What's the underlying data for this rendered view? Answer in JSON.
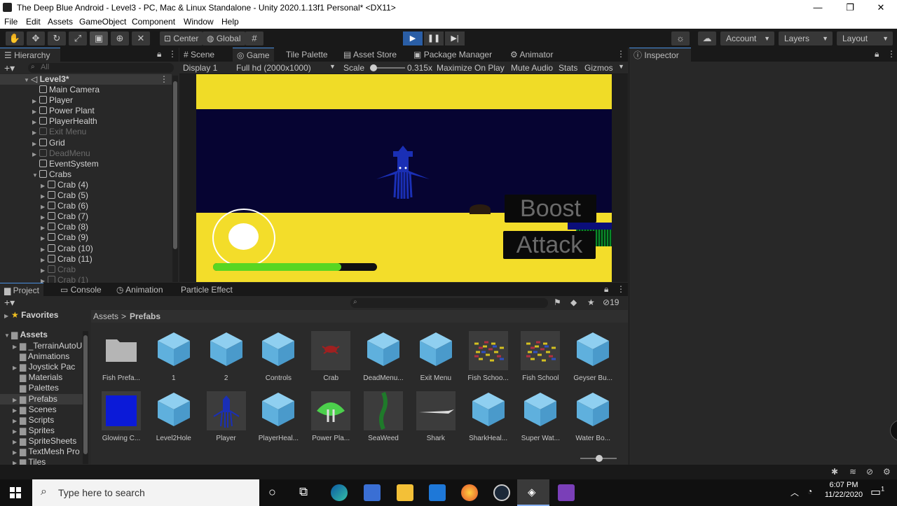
{
  "window": {
    "title": "The Deep Blue Android - Level3 - PC, Mac & Linux Standalone - Unity 2020.1.13f1 Personal* <DX11>",
    "minimize": "—",
    "maximize": "❐",
    "close": "✕"
  },
  "menu": [
    "File",
    "Edit",
    "Assets",
    "GameObject",
    "Component",
    "Window",
    "Help"
  ],
  "toolbar": {
    "pivot_label": "Center",
    "space_label": "Global",
    "account_label": "Account",
    "layers_label": "Layers",
    "layout_label": "Layout"
  },
  "hierarchy": {
    "tab": "Hierarchy",
    "search_placeholder": "All",
    "scene": "Level3*",
    "items": [
      {
        "label": "Main Camera",
        "dim": false,
        "indent": 1,
        "arrow": false
      },
      {
        "label": "Player",
        "dim": false,
        "indent": 1,
        "arrow": true
      },
      {
        "label": "Power Plant",
        "dim": false,
        "indent": 1,
        "arrow": true
      },
      {
        "label": "PlayerHealth",
        "dim": false,
        "indent": 1,
        "arrow": true
      },
      {
        "label": "Exit Menu",
        "dim": true,
        "indent": 1,
        "arrow": true
      },
      {
        "label": "Grid",
        "dim": false,
        "indent": 1,
        "arrow": true
      },
      {
        "label": "DeadMenu",
        "dim": true,
        "indent": 1,
        "arrow": true
      },
      {
        "label": "EventSystem",
        "dim": false,
        "indent": 1,
        "arrow": false
      },
      {
        "label": "Crabs",
        "dim": false,
        "indent": 1,
        "arrow": "open"
      },
      {
        "label": "Crab (4)",
        "dim": false,
        "indent": 2,
        "arrow": true
      },
      {
        "label": "Crab (5)",
        "dim": false,
        "indent": 2,
        "arrow": true
      },
      {
        "label": "Crab (6)",
        "dim": false,
        "indent": 2,
        "arrow": true
      },
      {
        "label": "Crab (7)",
        "dim": false,
        "indent": 2,
        "arrow": true
      },
      {
        "label": "Crab (8)",
        "dim": false,
        "indent": 2,
        "arrow": true
      },
      {
        "label": "Crab (9)",
        "dim": false,
        "indent": 2,
        "arrow": true
      },
      {
        "label": "Crab (10)",
        "dim": false,
        "indent": 2,
        "arrow": true
      },
      {
        "label": "Crab (11)",
        "dim": false,
        "indent": 2,
        "arrow": true
      },
      {
        "label": "Crab",
        "dim": true,
        "indent": 2,
        "arrow": true
      },
      {
        "label": "Crab (1)",
        "dim": true,
        "indent": 2,
        "arrow": true
      }
    ]
  },
  "center_tabs": [
    "Scene",
    "Game",
    "Tile Palette",
    "Asset Store",
    "Package Manager",
    "Animator"
  ],
  "game_toolbar": {
    "display": "Display 1",
    "resolution": "Full hd (2000x1000)",
    "scale_label": "Scale",
    "scale_value": "0.315x",
    "maximize": "Maximize On Play",
    "mute": "Mute Audio",
    "stats": "Stats",
    "gizmos": "Gizmos"
  },
  "game": {
    "boost_label": "Boost",
    "attack_label": "Attack",
    "health_fraction": 0.78
  },
  "inspector": {
    "tab": "Inspector"
  },
  "bottom_tabs": [
    "Project",
    "Console",
    "Animation",
    "Particle Effect"
  ],
  "project": {
    "hidden_count": "19",
    "favorites": "Favorites",
    "assets_root": "Assets",
    "breadcrumb_root": "Assets",
    "breadcrumb_sep": ">",
    "breadcrumb_current": "Prefabs",
    "folders": [
      "_TerrainAutoU",
      "Animations",
      "Joystick Pac",
      "Materials",
      "Palettes",
      "Prefabs",
      "Scenes",
      "Scripts",
      "Sprites",
      "SpriteSheets",
      "TextMesh Pro",
      "Tiles"
    ],
    "items_row1": [
      {
        "label": "Fish Prefa...",
        "kind": "folder"
      },
      {
        "label": "1",
        "kind": "cube"
      },
      {
        "label": "2",
        "kind": "cube"
      },
      {
        "label": "Controls",
        "kind": "cube"
      },
      {
        "label": "Crab",
        "kind": "crab"
      },
      {
        "label": "DeadMenu...",
        "kind": "cube"
      },
      {
        "label": "Exit Menu",
        "kind": "cube"
      },
      {
        "label": "Fish Schoo...",
        "kind": "fish"
      },
      {
        "label": "Fish School",
        "kind": "fish"
      },
      {
        "label": "Geyser Bu...",
        "kind": "cube"
      }
    ],
    "items_row2": [
      {
        "label": "Glowing C...",
        "kind": "blue"
      },
      {
        "label": "Level2Hole",
        "kind": "cube"
      },
      {
        "label": "Player",
        "kind": "squid"
      },
      {
        "label": "PlayerHeal...",
        "kind": "cube"
      },
      {
        "label": "Power Pla...",
        "kind": "plant"
      },
      {
        "label": "SeaWeed",
        "kind": "weed"
      },
      {
        "label": "Shark",
        "kind": "shark"
      },
      {
        "label": "SharkHeal...",
        "kind": "cube"
      },
      {
        "label": "Super Wat...",
        "kind": "cube"
      },
      {
        "label": "Water Bo...",
        "kind": "cube"
      }
    ]
  },
  "taskbar": {
    "search_placeholder": "Type here to search",
    "time": "6:07 PM",
    "date": "11/22/2020",
    "notif_count": "1"
  },
  "colors": {
    "accent": "#2a5ea6",
    "sand": "#f3dd2a",
    "sea": "#060432",
    "health": "#58d622",
    "cube": "#5fb0dd"
  }
}
